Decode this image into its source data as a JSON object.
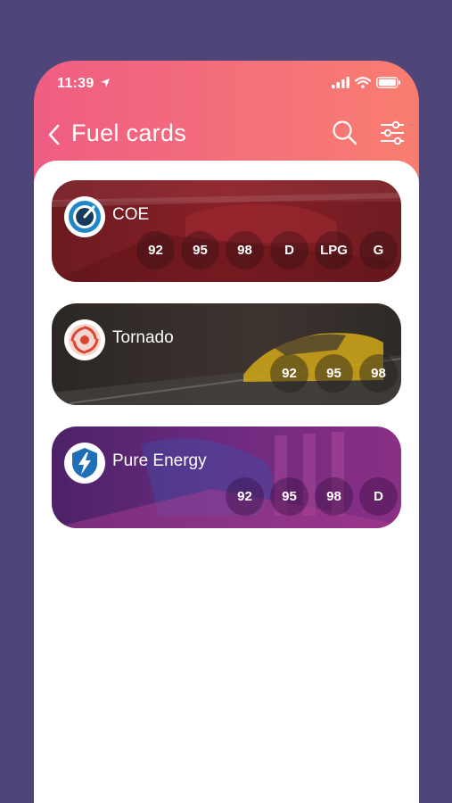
{
  "status_bar": {
    "time": "11:39"
  },
  "header": {
    "title": "Fuel cards"
  },
  "cards": [
    {
      "name": "COE",
      "logo_icon": "coe-gauge-logo",
      "fuels": [
        "92",
        "95",
        "98",
        "D",
        "LPG",
        "G"
      ]
    },
    {
      "name": "Tornado",
      "logo_icon": "tornado-swirl-logo",
      "fuels": [
        "92",
        "95",
        "98"
      ]
    },
    {
      "name": "Pure Energy",
      "logo_icon": "lightning-shield-logo",
      "fuels": [
        "92",
        "95",
        "98",
        "D"
      ]
    }
  ],
  "colors": {
    "background": "#4e4679",
    "header_gradient_start": "#ef5d83",
    "header_gradient_end": "#f97d6f",
    "coe_card": "#7a1c22",
    "tornado_card": "#3a2f2b",
    "pure_energy_card": "#6a2a7e"
  }
}
